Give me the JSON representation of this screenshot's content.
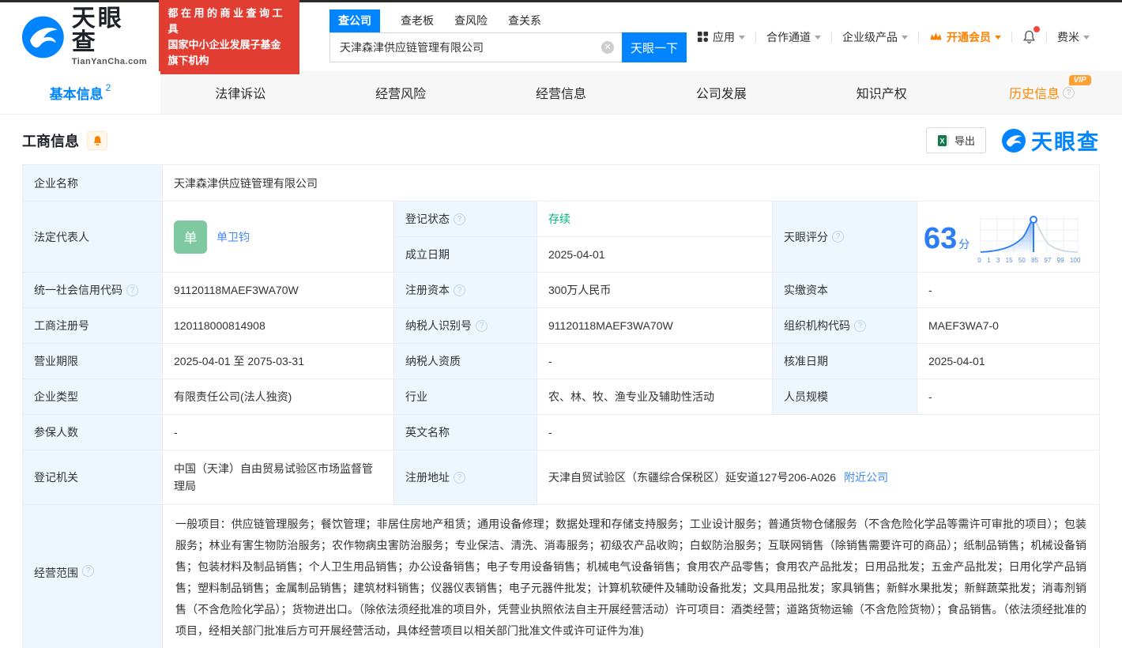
{
  "colors": {
    "accent_blue": "#0084ff",
    "banner_red": "#e23d33",
    "vip_orange": "#ff8000",
    "status_green": "#00b578",
    "link_blue": "#4387f4",
    "score_blue": "#2b7cf5",
    "avatar_green": "#7ec9a2"
  },
  "header": {
    "logo": {
      "brand": "天眼查",
      "domain": "TianYanCha.com"
    },
    "slogan": {
      "line1": "都在用的商业查询工具",
      "line2": "国家中小企业发展子基金旗下机构"
    },
    "search": {
      "tabs": [
        {
          "label": "查公司",
          "active": true
        },
        {
          "label": "查老板"
        },
        {
          "label": "查风险"
        },
        {
          "label": "查关系"
        }
      ],
      "value": "天津森津供应链管理有限公司",
      "button": "天眼一下"
    },
    "nav": [
      {
        "label": "应用",
        "icon": "grid-icon"
      },
      {
        "label": "合作通道"
      },
      {
        "label": "企业级产品"
      },
      {
        "label": "开通会员",
        "icon": "crown-icon",
        "highlight": true
      },
      {
        "label": "费米"
      }
    ]
  },
  "tabs": [
    {
      "label": "基本信息",
      "badge": "2",
      "active": true
    },
    {
      "label": "法律诉讼"
    },
    {
      "label": "经营风险"
    },
    {
      "label": "经营信息"
    },
    {
      "label": "公司发展"
    },
    {
      "label": "知识产权"
    },
    {
      "label": "历史信息",
      "vip_badge": "VIP",
      "help": true
    }
  ],
  "section": {
    "title": "工商信息",
    "export_label": "导出",
    "brand": "天眼查"
  },
  "info": {
    "name": {
      "label": "企业名称",
      "value": "天津森津供应链管理有限公司"
    },
    "legal_rep": {
      "label": "法定代表人",
      "avatar_char": "单",
      "name": "单卫钧"
    },
    "reg_status": {
      "label": "登记状态",
      "value": "存续"
    },
    "establish_date": {
      "label": "成立日期",
      "value": "2025-04-01"
    },
    "score": {
      "label": "天眼评分",
      "value": "63",
      "unit": "分",
      "ticks": [
        "0",
        "1",
        "3",
        "15",
        "50",
        "85",
        "97",
        "99",
        "100"
      ]
    },
    "credit_code": {
      "label": "统一社会信用代码",
      "value": "91120118MAEF3WA70W"
    },
    "reg_capital": {
      "label": "注册资本",
      "value": "300万人民币"
    },
    "paid_capital": {
      "label": "实缴资本",
      "value": "-"
    },
    "reg_number": {
      "label": "工商注册号",
      "value": "120118000814908"
    },
    "taxpayer_id": {
      "label": "纳税人识别号",
      "value": "91120118MAEF3WA70W"
    },
    "org_code": {
      "label": "组织机构代码",
      "value": "MAEF3WA7-0"
    },
    "business_term": {
      "label": "营业期限",
      "value": "2025-04-01 至 2075-03-31"
    },
    "taxpayer_qualification": {
      "label": "纳税人资质",
      "value": "-"
    },
    "approval_date": {
      "label": "核准日期",
      "value": "2025-04-01"
    },
    "company_type": {
      "label": "企业类型",
      "value": "有限责任公司(法人独资)"
    },
    "industry": {
      "label": "行业",
      "value": "农、林、牧、渔专业及辅助性活动"
    },
    "staff_size": {
      "label": "人员规模",
      "value": "-"
    },
    "insured_count": {
      "label": "参保人数",
      "value": "-"
    },
    "english_name": {
      "label": "英文名称",
      "value": "-"
    },
    "registration_authority": {
      "label": "登记机关",
      "value": "中国（天津）自由贸易试验区市场监督管理局"
    },
    "registered_address": {
      "label": "注册地址",
      "value": "天津自贸试验区（东疆综合保税区）延安道127号206-A026",
      "nearby_link": "附近公司"
    },
    "business_scope": {
      "label": "经营范围",
      "value": "一般项目：供应链管理服务；餐饮管理；非居住房地产租赁；通用设备修理；数据处理和存储支持服务；工业设计服务；普通货物仓储服务（不含危险化学品等需许可审批的项目）；包装服务；林业有害生物防治服务；农作物病虫害防治服务；专业保洁、清洗、消毒服务；初级农产品收购；白蚁防治服务；互联网销售（除销售需要许可的商品）；纸制品销售；机械设备销售；包装材料及制品销售；个人卫生用品销售；办公设备销售；电子专用设备销售；机械电气设备销售；食用农产品零售；食用农产品批发；日用品批发；五金产品批发；日用化学产品销售；塑料制品销售；金属制品销售；建筑材料销售；仪器仪表销售；电子元器件批发；计算机软硬件及辅助设备批发；文具用品批发；家具销售；新鲜水果批发；新鲜蔬菜批发；消毒剂销售（不含危险化学品）；货物进出口。（除依法须经批准的项目外，凭营业执照依法自主开展经营活动）许可项目：酒类经营；道路货物运输（不含危险货物）；食品销售。（依法须经批准的项目，经相关部门批准后方可开展经营活动，具体经营项目以相关部门批准文件或许可证件为准)"
    }
  }
}
